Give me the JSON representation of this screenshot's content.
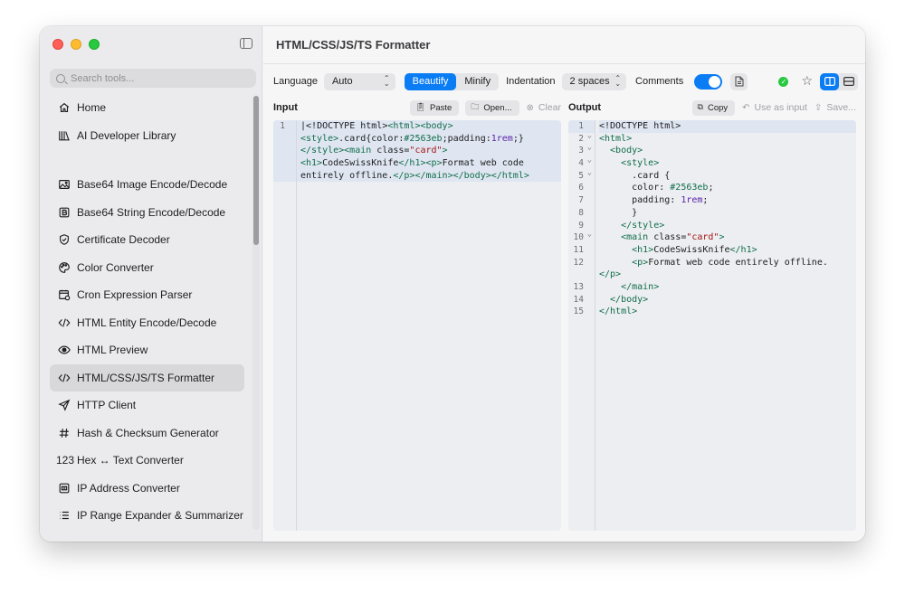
{
  "window": {
    "title": "HTML/CSS/JS/TS Formatter"
  },
  "sidebar": {
    "search_placeholder": "Search tools...",
    "items": [
      {
        "label": "Home",
        "icon": "home-icon"
      },
      {
        "label": "AI Developer Library",
        "icon": "library-icon"
      },
      {
        "label": "Base64 Image Encode/Decode",
        "icon": "image-icon"
      },
      {
        "label": "Base64 String Encode/Decode",
        "icon": "b-box-icon"
      },
      {
        "label": "Certificate Decoder",
        "icon": "shield-check-icon"
      },
      {
        "label": "Color Converter",
        "icon": "palette-icon"
      },
      {
        "label": "Cron Expression Parser",
        "icon": "calendar-clock-icon"
      },
      {
        "label": "HTML Entity Encode/Decode",
        "icon": "code-brackets-icon"
      },
      {
        "label": "HTML Preview",
        "icon": "eye-icon"
      },
      {
        "label": "HTML/CSS/JS/TS Formatter",
        "icon": "code-brackets-icon",
        "active": true
      },
      {
        "label": "HTTP Client",
        "icon": "send-icon"
      },
      {
        "label": "Hash & Checksum Generator",
        "icon": "hash-icon"
      },
      {
        "label": "Hex ↔ Text Converter",
        "icon": "123-icon",
        "icon_text": "123"
      },
      {
        "label": "IP Address Converter",
        "icon": "ip-icon"
      },
      {
        "label": "IP Range Expander & Summarizer",
        "icon": "list-icon"
      }
    ]
  },
  "toolbar": {
    "language_label": "Language",
    "language_value": "Auto",
    "beautify_label": "Beautify",
    "minify_label": "Minify",
    "indentation_label": "Indentation",
    "indentation_value": "2 spaces",
    "comments_label": "Comments",
    "comments_on": true,
    "accent_color": "#0a7cf4",
    "status_color": "#28c840"
  },
  "input": {
    "title": "Input",
    "paste_label": "Paste",
    "open_label": "Open...",
    "clear_label": "Clear",
    "gutter": [
      "1"
    ],
    "lines": [
      "<!DOCTYPE html><html><body>",
      "<style>.card{color:#2563eb;padding:1rem;}",
      "</style><main class=\"card\">",
      "<h1>CodeSwissKnife</h1><p>Format web code",
      "entirely offline.</p></main></body></html>"
    ]
  },
  "output": {
    "title": "Output",
    "copy_label": "Copy",
    "use_as_input_label": "Use as input",
    "save_label": "Save...",
    "gutter": [
      "1",
      "2",
      "3",
      "4",
      "5",
      "6",
      "7",
      "8",
      "9",
      "10",
      "11",
      "12",
      "",
      "13",
      "14",
      "15"
    ],
    "folds": [
      2,
      3,
      4,
      5,
      10
    ],
    "lines": [
      "<!DOCTYPE html>",
      "<html>",
      "  <body>",
      "    <style>",
      "      .card {",
      "      color: #2563eb;",
      "      padding: 1rem;",
      "      }",
      "    </style>",
      "    <main class=\"card\">",
      "      <h1>CodeSwissKnife</h1>",
      "      <p>Format web code entirely offline.",
      "</p>",
      "    </main>",
      "  </body>",
      "</html>"
    ]
  }
}
